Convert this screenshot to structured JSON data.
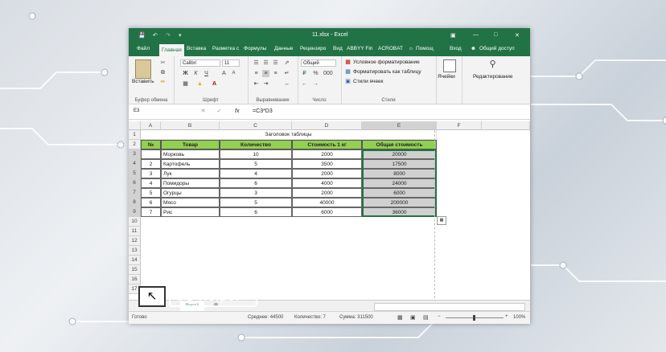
{
  "window": {
    "title": "11.xlsx - Excel"
  },
  "tabs": [
    "Файл",
    "Главная",
    "Вставка",
    "Разметка с",
    "Формулы",
    "Данные",
    "Рецензиро",
    "Вид",
    "ABBYY Fin",
    "ACROBAT",
    "Помощ",
    "Вход",
    "Общий доступ"
  ],
  "ribbon": {
    "paste": "Вставить",
    "font_name": "Calibri",
    "font_size": "11",
    "bold": "Ж",
    "italic": "К",
    "underline": "Ч",
    "number_format": "Общий",
    "cond_format": "Условное форматирование",
    "format_table": "Форматировать как таблицу",
    "cell_styles": "Стили ячеек",
    "cells": "Ячейки",
    "editing": "Редактирование",
    "groups": [
      "Буфер обмена",
      "Шрифт",
      "Выравнивание",
      "Число",
      "Стили"
    ]
  },
  "formula_bar": {
    "name_box": "E3",
    "fx": "fx",
    "formula": "=C3*D3"
  },
  "columns": [
    "A",
    "B",
    "C",
    "D",
    "E",
    "F"
  ],
  "rows": [
    "1",
    "2",
    "3",
    "4",
    "5",
    "6",
    "7",
    "8",
    "9",
    "10",
    "11",
    "12",
    "13",
    "14",
    "15",
    "16",
    "17"
  ],
  "table": {
    "title": "Заголовок таблицы",
    "headers": [
      "№",
      "Товар",
      "Количество",
      "Стоимость 1 кг",
      "Общая стоимость"
    ],
    "data": [
      [
        "",
        "Морковь",
        "10",
        "2000",
        "20000"
      ],
      [
        "2",
        "Картофель",
        "5",
        "3500",
        "17500"
      ],
      [
        "3",
        "Лук",
        "4",
        "2000",
        "8000"
      ],
      [
        "4",
        "Помидоры",
        "6",
        "4000",
        "24000"
      ],
      [
        "5",
        "Огурцы",
        "3",
        "2000",
        "6000"
      ],
      [
        "6",
        "Мясо",
        "5",
        "40000",
        "200000"
      ],
      [
        "7",
        "Рис",
        "6",
        "6000",
        "36000"
      ]
    ]
  },
  "sheet_tab": "Лист1",
  "status": {
    "ready": "Готово",
    "average": "Среднее: 44500",
    "count": "Количество: 7",
    "sum": "Сумма: 311500",
    "zoom": "100%"
  },
  "watermark": {
    "text": "OS Helper"
  }
}
